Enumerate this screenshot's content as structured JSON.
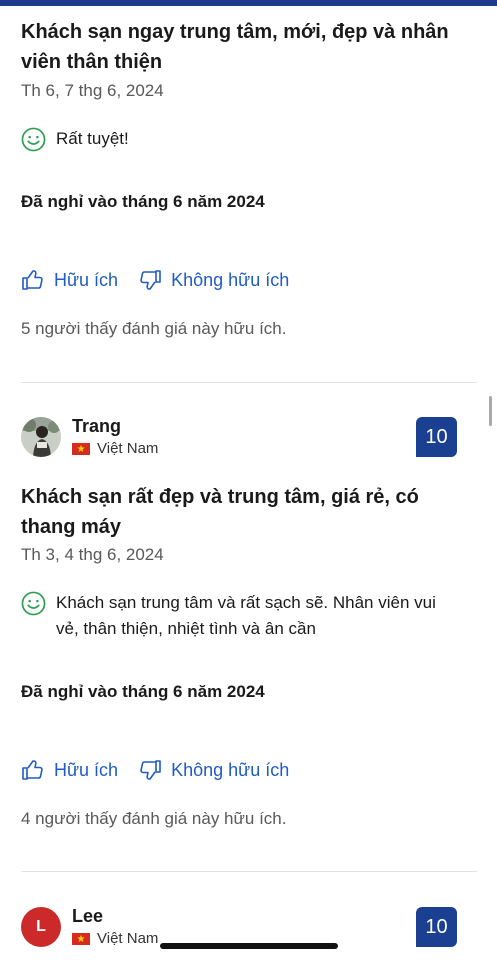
{
  "reviews": [
    {
      "title_line1": "Khách sạn ngay trung tâm, mới, đẹp và nhân",
      "title_line2": "viên thân thiện",
      "date": "Th 6, 7 thg 6, 2024",
      "comment_line1": "Rất tuyệt!",
      "stay": "Đã nghỉ vào tháng 6 năm 2024",
      "helpful_label": "Hữu ích",
      "not_helpful_label": "Không hữu ích",
      "helpful_count": "5 người thấy đánh giá này hữu ích."
    },
    {
      "reviewer_name": "Trang",
      "country": "Việt Nam",
      "score": "10",
      "title_line1": "Khách sạn rất đẹp và trung tâm, giá rẻ, có",
      "title_line2": "thang máy",
      "date": "Th 3, 4 thg 6, 2024",
      "comment_line1": "Khách sạn trung tâm và rất sạch sẽ. Nhân viên vui",
      "comment_line2": "vẻ, thân thiện, nhiệt tình và ân cần",
      "stay": "Đã nghỉ vào tháng 6 năm 2024",
      "helpful_label": "Hữu ích",
      "not_helpful_label": "Không hữu ích",
      "helpful_count": "4 người thấy đánh giá này hữu ích."
    },
    {
      "reviewer_name": "Lee",
      "avatar_letter": "L",
      "country": "Việt Nam",
      "score": "10"
    }
  ],
  "icons": {
    "smile": "smile-icon",
    "thumbs_up": "thumbs-up-icon",
    "thumbs_down": "thumbs-down-icon"
  },
  "colors": {
    "accent": "#1f5cc4",
    "score_badge": "#1b3f91",
    "positive": "#2e9e4f",
    "avatar_lee": "#cc2a2a"
  }
}
